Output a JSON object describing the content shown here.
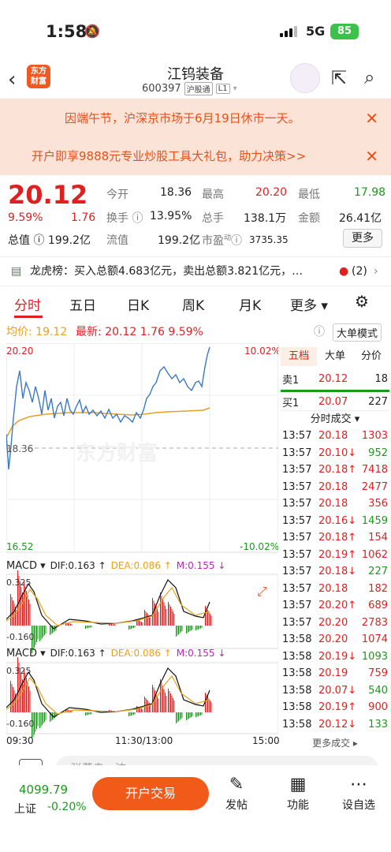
{
  "status": {
    "time": "1:58",
    "net": "5G",
    "battery": "85"
  },
  "header": {
    "title": "江钨装备",
    "code": "600397",
    "tag1": "沪股通",
    "tag2": "L1",
    "logo_line1": "东方",
    "logo_line2": "财富"
  },
  "banners": {
    "holiday": "因端午节，沪深京市场于6月19日休市一天。",
    "promo": "开户即享9888元专业炒股工具大礼包，助力决策>>"
  },
  "quote": {
    "price": "20.12",
    "pct": "9.59%",
    "chg": "1.76",
    "labels": {
      "open": "今开",
      "high": "最高",
      "low": "最低",
      "turnover": "换手",
      "volume": "总手",
      "amount": "金额",
      "mktcap": "总值",
      "float": "流值",
      "pe": "市盈"
    },
    "open": "18.36",
    "high": "20.20",
    "low": "17.98",
    "turnover": "13.95%",
    "volume": "138.1万",
    "amount": "26.41亿",
    "mktcap": "199.2亿",
    "float": "199.2亿",
    "pe_sup": "动",
    "pe": "3735.35",
    "more": "更多"
  },
  "lhb": {
    "text": "龙虎榜：买入总额4.683亿元，卖出总额3.821亿元，…",
    "count": "(2)"
  },
  "tabs": [
    "分时",
    "五日",
    "日K",
    "周K",
    "月K",
    "更多"
  ],
  "info": {
    "avg_label": "均价:",
    "avg": "19.12",
    "last_label": "最新:",
    "last": "20.12",
    "chg": "1.76",
    "pct": "9.59%",
    "big": "大单模式"
  },
  "axis": {
    "top": "20.20",
    "mid": "18.36",
    "bottom": "16.52",
    "pct_top": "10.02%",
    "pct_bottom": "-10.02%",
    "t0": "09:30",
    "t1": "11:30/13:00",
    "t2": "15:00",
    "watermark": "东方财富"
  },
  "macd": {
    "name": "MACD",
    "dif": "DIF:0.163 ↑",
    "dea": "DEA:0.086 ↑",
    "m": "M:0.155 ↓",
    "top": "0.325",
    "bottom": "-0.160"
  },
  "side": {
    "tabs": [
      "五档",
      "大单",
      "分价"
    ],
    "sell_label": "卖1",
    "sell_price": "20.12",
    "sell_vol": "18",
    "buy_label": "买1",
    "buy_price": "20.07",
    "buy_vol": "227",
    "ticks_title": "分时成交",
    "more": "更多成交",
    "ticks": [
      [
        "13:57",
        "20.18",
        "1303",
        "r"
      ],
      [
        "13:57",
        "20.10↓",
        "952",
        "g"
      ],
      [
        "13:57",
        "20.18↑",
        "7418",
        "r"
      ],
      [
        "13:57",
        "20.18",
        "2477",
        "r"
      ],
      [
        "13:57",
        "20.18",
        "356",
        "r"
      ],
      [
        "13:57",
        "20.16↓",
        "1459",
        "g"
      ],
      [
        "13:57",
        "20.18↑",
        "154",
        "r"
      ],
      [
        "13:57",
        "20.19↑",
        "1062",
        "r"
      ],
      [
        "13:57",
        "20.18↓",
        "227",
        "g"
      ],
      [
        "13:57",
        "20.18",
        "182",
        "r"
      ],
      [
        "13:57",
        "20.20↑",
        "689",
        "r"
      ],
      [
        "13:57",
        "20.20",
        "2783",
        "r"
      ],
      [
        "13:58",
        "20.20",
        "1074",
        "r"
      ],
      [
        "13:58",
        "20.19↓",
        "1093",
        "g"
      ],
      [
        "13:58",
        "20.19",
        "759",
        "r"
      ],
      [
        "13:58",
        "20.07↓",
        "540",
        "g"
      ],
      [
        "13:58",
        "20.19↑",
        "900",
        "r"
      ],
      [
        "13:58",
        "20.12↓",
        "133",
        "g"
      ]
    ]
  },
  "input_placeholder": "弹幕走一波",
  "bottom": {
    "index": "4099.79",
    "index_name": "上证",
    "index_pct": "-0.20%",
    "trade": "开户交易",
    "post": "发帖",
    "func": "功能",
    "settings": "设自选"
  }
}
